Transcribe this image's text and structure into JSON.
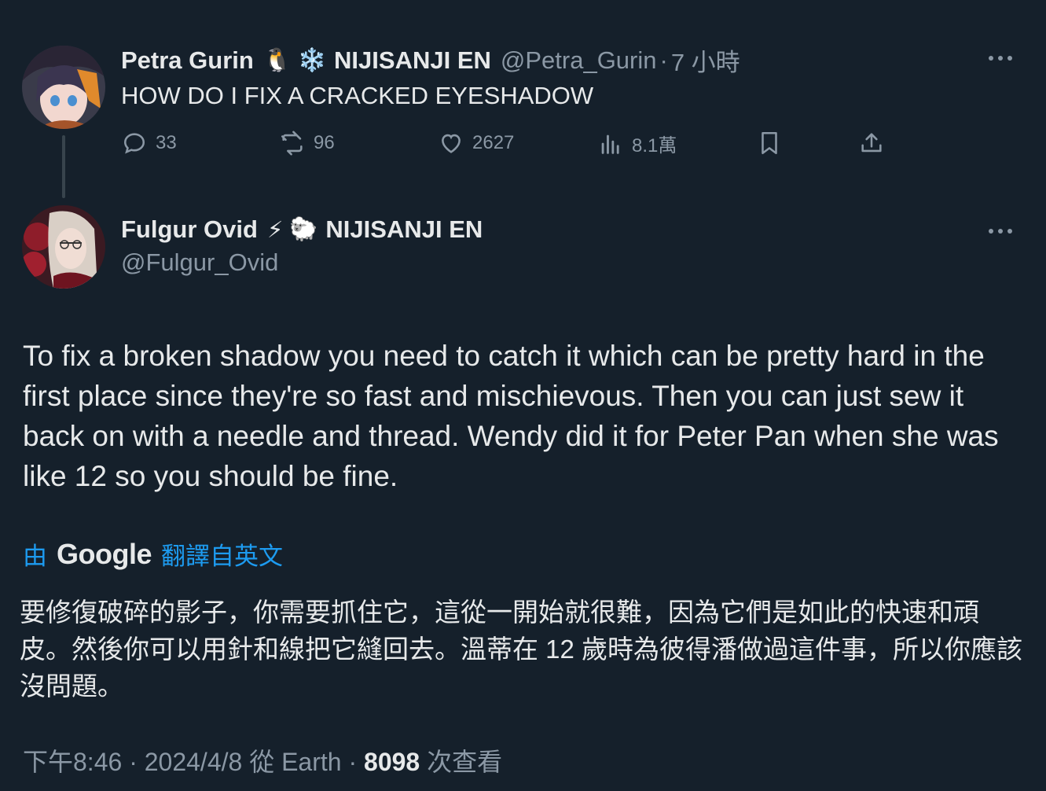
{
  "parent_tweet": {
    "display_name": "Petra Gurin",
    "badge_emoji": "🐧",
    "group_emoji": "❄️",
    "group": "NIJISANJI EN",
    "handle": "@Petra_Gurin",
    "separator": "·",
    "time_ago": "7 小時",
    "text": "HOW DO I FIX A CRACKED EYESHADOW",
    "actions": {
      "replies": "33",
      "retweets": "96",
      "likes": "2627",
      "views": "8.1萬"
    }
  },
  "reply_tweet": {
    "display_name": "Fulgur Ovid",
    "badge_emoji": "⚡",
    "group_emoji": "🐑",
    "group": "NIJISANJI EN",
    "handle": "@Fulgur_Ovid",
    "text": "To fix a broken shadow you need to catch it which can be pretty hard in the first place since they're so fast and mischievous. Then you can just sew it back on with a needle and thread. Wendy did it for Peter Pan when she was like 12 so you should be fine.",
    "translation": {
      "by_label": "由",
      "provider": "Google",
      "from_label": "翻譯自英文",
      "text": "要修復破碎的影子，你需要抓住它，這從一開始就很難，因為它們是如此的快速和頑皮。然後你可以用針和線把它縫回去。溫蒂在 12 歲時為彼得潘做過這件事，所以你應該沒問題。"
    },
    "meta": {
      "time": "下午8:46",
      "sep1": "·",
      "date": "2024/4/8",
      "source": "從 Earth",
      "sep2": "·",
      "views": "8098",
      "views_label": "次查看"
    }
  },
  "colors": {
    "background": "#15202b",
    "text_primary": "#e7e9ea",
    "text_secondary": "#8b98a5",
    "accent": "#1d9bf0",
    "thread_line": "#38444d"
  },
  "icons": [
    "reply-icon",
    "retweet-icon",
    "like-icon",
    "views-icon",
    "bookmark-icon",
    "share-icon",
    "more-icon"
  ]
}
